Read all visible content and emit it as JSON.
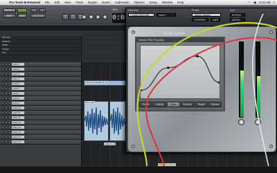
{
  "menubar": {
    "apple": "",
    "app_name": "Pro Tools M-Powered",
    "items": [
      "File",
      "Edit",
      "View",
      "Track",
      "Region",
      "Event",
      "AudioSuite",
      "Options",
      "Setup",
      "Window",
      "Help"
    ],
    "clock": "8:22 AM"
  },
  "toolbar": {
    "btn_a": "SHUFFLE",
    "btn_b": "SPOT",
    "btn_c": "SLIP",
    "btn_d": "GRID",
    "counter_label": "Main",
    "counter_value": "0:00.000",
    "info_cursor": "Cursor",
    "info_nudge": "Nudge"
  },
  "edit_window": {
    "title": "Edit: Untitled Session",
    "rulers": [
      "Min:Sec",
      "Markers",
      "Meter",
      "Tempo",
      "Key"
    ],
    "tracks": [
      "Audio 1",
      "Audio 2",
      "Audio 3",
      "Audio 4",
      "Audio 5",
      "Audio 6",
      "Audio 7",
      "Audio 8",
      "Audio 9",
      "Audio 10",
      "Audio 11",
      "Audio 12",
      "Audio 13",
      "Audio 14",
      "Audio 15",
      "Audio 16",
      "Audio 17"
    ],
    "clip_label_a": "Harmonic Deluge 01_07",
    "clip_label_b": "Vox 1_02",
    "clip_label_c": "Audio 3_01",
    "marker": "Pickup for Verse 2"
  },
  "plugin": {
    "top_labels": {
      "selection": "Selection",
      "preset": "Preset",
      "auto": "Auto"
    },
    "track_field": "1 LEAD VOCOMP",
    "preset_field": "<factory default>",
    "bypass": "BYPASS",
    "compare": "COMPARE",
    "safe": "SAFE",
    "native": "NATIVE",
    "insert": "Insert 1",
    "plugin_name": "Voice Synth",
    "graph_header": "Selected Filter Properties",
    "graph_buttons": [
      "Global",
      "Velocity",
      "Pitch",
      "Formant",
      "Target",
      "Options"
    ],
    "selected_button": "Pitch"
  },
  "meters": {
    "left_level": 0.62,
    "right_level": 0.55
  },
  "chart_curve": {
    "points": [
      [
        0,
        0.85
      ],
      [
        0.35,
        0.42
      ],
      [
        0.72,
        0.2
      ],
      [
        1,
        0.7
      ]
    ]
  }
}
